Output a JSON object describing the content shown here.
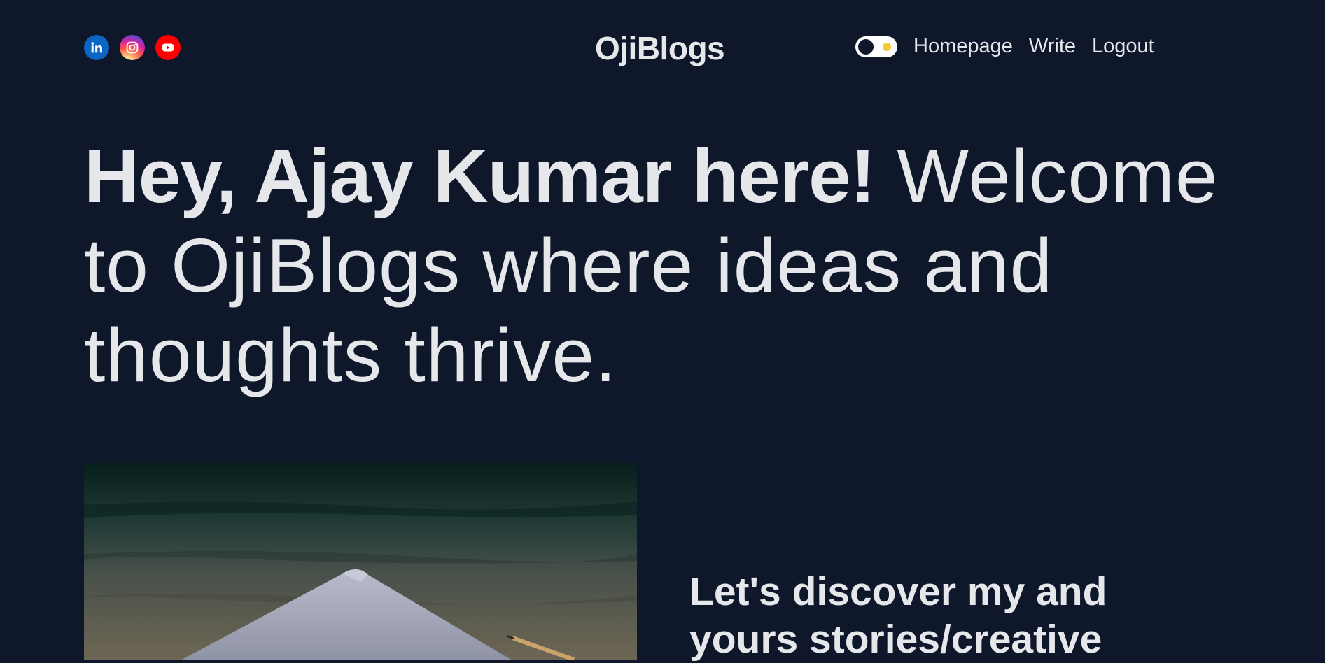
{
  "brand": {
    "logo_text": "OjiBlogs"
  },
  "socials": [
    {
      "name": "linkedin-icon",
      "color": "#0a66c2"
    },
    {
      "name": "instagram-icon",
      "color": "#d6249f"
    },
    {
      "name": "youtube-icon",
      "color": "#ff0000"
    }
  ],
  "nav": {
    "theme_toggle": "dark",
    "links": [
      "Homepage",
      "Write",
      "Logout"
    ]
  },
  "hero": {
    "greeting": "Hey, Ajay Kumar here!",
    "tagline": " Welcome to OjiBlogs where ideas and thoughts thrive."
  },
  "featured_post": {
    "title": "Let's discover my and yours stories/creative"
  },
  "colors": {
    "background": "#0f172a",
    "text": "#e5e7eb",
    "toggle_sun": "#f6c933"
  }
}
